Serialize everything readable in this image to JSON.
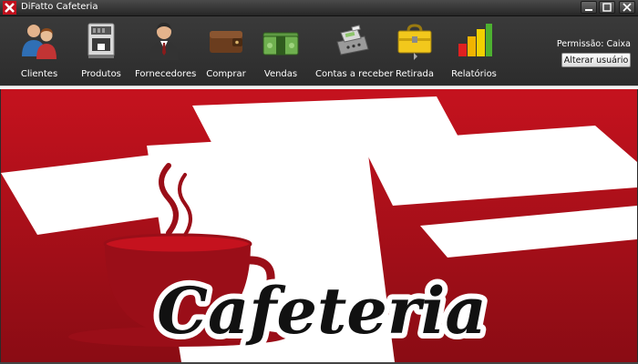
{
  "window": {
    "title": "DiFatto Cafeteria",
    "accent": "#c0101c"
  },
  "toolbar": {
    "items": [
      {
        "label": "Clientes",
        "icon": "users-icon"
      },
      {
        "label": "Produtos",
        "icon": "coffee-machine-icon"
      },
      {
        "label": "Fornecedores",
        "icon": "businessman-icon"
      },
      {
        "label": "Comprar",
        "icon": "wallet-icon"
      },
      {
        "label": "Vendas",
        "icon": "money-icon"
      },
      {
        "label": "Contas a receber",
        "icon": "cash-register-icon"
      },
      {
        "label": "Retirada",
        "icon": "toolbox-icon"
      },
      {
        "label": "Relatórios",
        "icon": "bar-chart-icon"
      }
    ]
  },
  "user": {
    "permission_label": "Permissão: Caixa",
    "switch_user_button": "Alterar usuário"
  },
  "banner": {
    "logo_text": "Cafeteria",
    "colors": {
      "red": "#b8101c",
      "white": "#ffffff",
      "dark_red": "#8a0c14"
    }
  }
}
